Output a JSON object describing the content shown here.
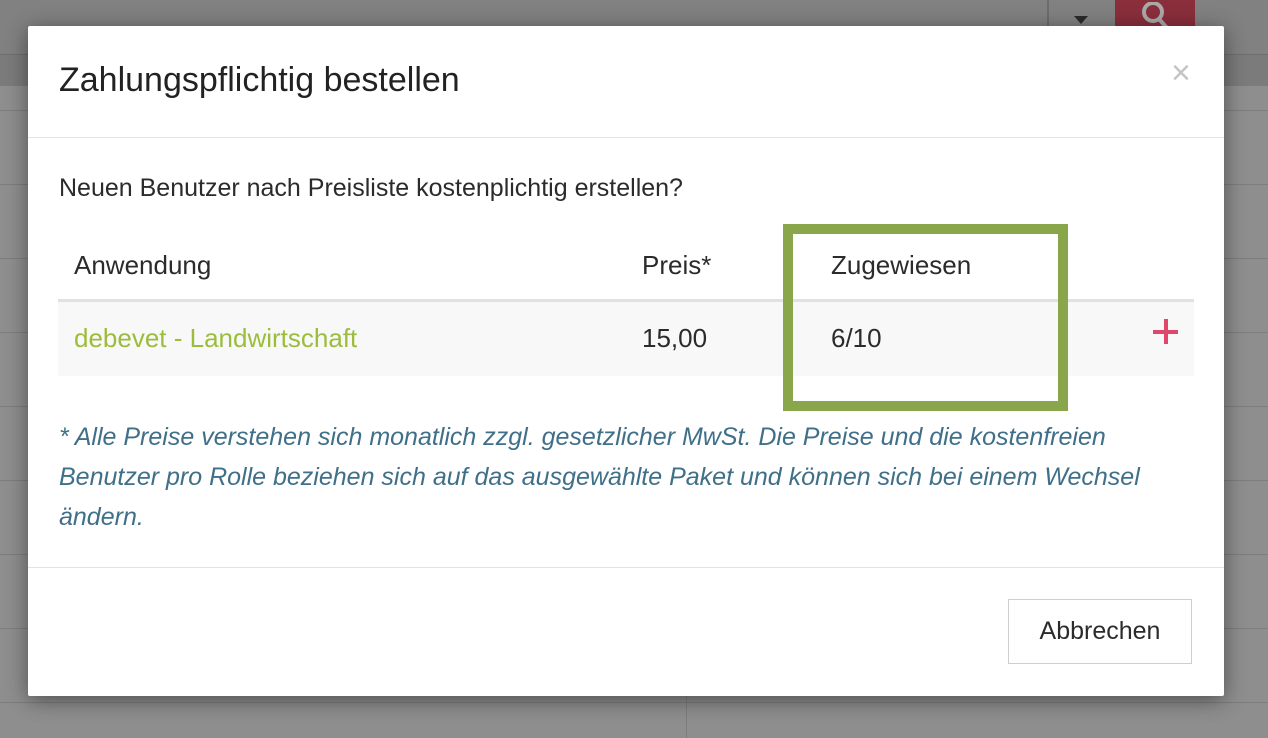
{
  "modal": {
    "title": "Zahlungspflichtig bestellen",
    "close_symbol": "×",
    "question": "Neuen Benutzer nach Preisliste kostenplichtig erstellen?",
    "table": {
      "headers": {
        "application": "Anwendung",
        "price": "Preis*",
        "assigned": "Zugewiesen"
      },
      "rows": [
        {
          "application": "debevet  -  Landwirtschaft",
          "price": "15,00",
          "assigned": "6/10",
          "action_icon": "plus-icon"
        }
      ]
    },
    "footnote": "* Alle Preise verstehen sich monatlich zzgl. gesetzlicher MwSt. Die Preise und die kostenfreien Benutzer pro Rolle beziehen sich auf das ausgewählte Paket und können sich bei einem Wechsel ändern.",
    "cancel_label": "Abbrechen"
  },
  "background": {
    "search_icon": "search-icon",
    "dropdown_icon": "caret-down-icon"
  },
  "colors": {
    "app_name": "#9cbd3c",
    "highlight": "#8aa64b",
    "plus": "#e0476a",
    "footnote": "#3f6f89",
    "search_button": "#8a2e3c"
  }
}
